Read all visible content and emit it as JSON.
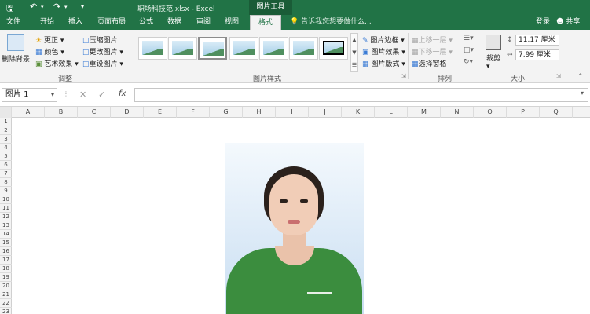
{
  "window": {
    "file_name": "职场科技范.xlsx",
    "app_name": "Excel",
    "separator": " - ",
    "context_tab_group": "图片工具"
  },
  "qat": {
    "save_icon": "save-icon",
    "undo_icon": "undo-icon",
    "redo_icon": "redo-icon",
    "customize_icon": "customize-qat-icon"
  },
  "tabs": [
    "文件",
    "开始",
    "插入",
    "页面布局",
    "公式",
    "数据",
    "审阅",
    "视图",
    "格式"
  ],
  "active_tab": "格式",
  "tell_me": "告诉我您想要做什么...",
  "account": {
    "login": "登录",
    "share": "共享"
  },
  "ribbon": {
    "adjust": {
      "remove_bg": "删除背景",
      "corrections": "更正",
      "color": "颜色",
      "artistic": "艺术效果",
      "compress": "压缩图片",
      "change": "更改图片",
      "reset": "重设图片",
      "group_label": "调整"
    },
    "styles": {
      "group_label": "图片样式",
      "border": "图片边框",
      "effects": "图片效果",
      "layout": "图片版式",
      "thumb_count": 7,
      "selected_index": 2
    },
    "arrange": {
      "bring_forward": "上移一层",
      "send_backward": "下移一层",
      "selection_pane": "选择窗格",
      "group_label": "排列"
    },
    "size": {
      "crop": "裁剪",
      "height": "11.17 厘米",
      "width": "7.99 厘米",
      "group_label": "大小"
    }
  },
  "formula_bar": {
    "name_box": "图片 1",
    "cancel": "✕",
    "enter": "✓",
    "fx": "fx",
    "formula": ""
  },
  "sheet": {
    "columns": [
      "A",
      "B",
      "C",
      "D",
      "E",
      "F",
      "G",
      "H",
      "I",
      "J",
      "K",
      "L",
      "M",
      "N",
      "O",
      "P",
      "Q"
    ],
    "rows": [
      "1",
      "2",
      "3",
      "4",
      "5",
      "6",
      "7",
      "8",
      "9",
      "10",
      "11",
      "12",
      "13",
      "14",
      "15",
      "16",
      "17",
      "18",
      "19",
      "20",
      "21",
      "22",
      "23"
    ]
  },
  "colors": {
    "excel_green": "#217346",
    "ribbon_bg": "#f3f3f3",
    "shirt": "#3b8d3e"
  }
}
